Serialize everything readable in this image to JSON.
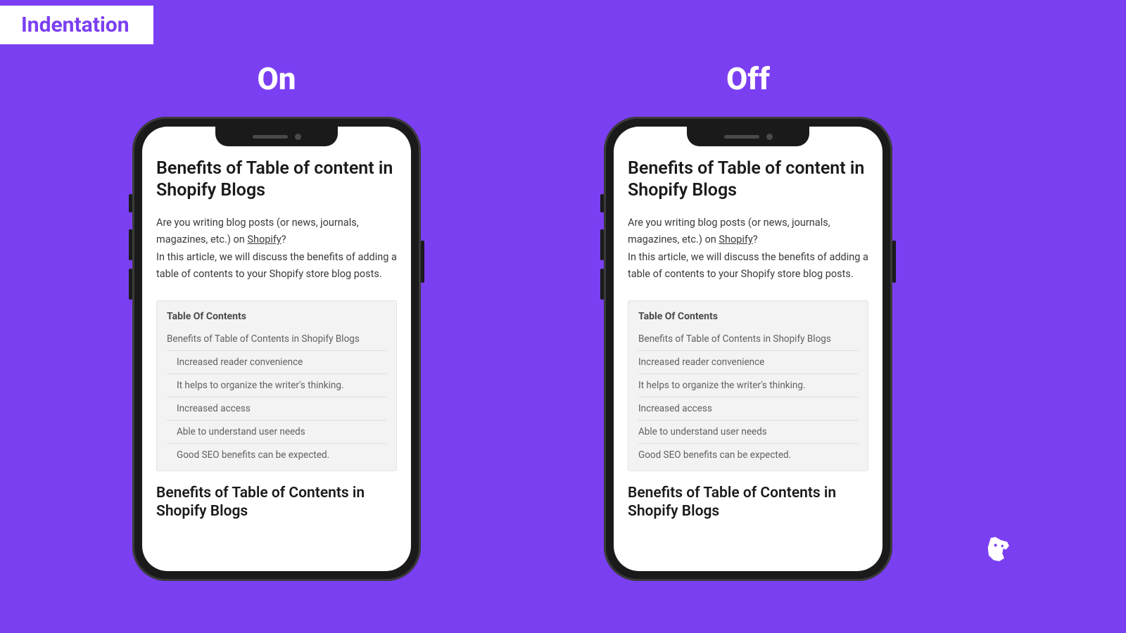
{
  "badge": "Indentation",
  "left": {
    "label": "On"
  },
  "right": {
    "label": "Off"
  },
  "article": {
    "title": "Benefits of Table of content in Shopify Blogs",
    "intro_a": "Are you writing blog posts (or news, journals, magazines, etc.) on ",
    "intro_link": "Shopify",
    "intro_b": "?",
    "intro_c": "In this article, we will discuss the benefits of adding a table of contents to your Shopify store blog posts.",
    "section_heading": "Benefits of Table of Contents in Shopify Blogs"
  },
  "toc": {
    "heading": "Table Of Contents",
    "items": [
      {
        "label": "Benefits of Table of Contents in Shopify Blogs",
        "level": 0
      },
      {
        "label": "Increased reader convenience",
        "level": 1
      },
      {
        "label": "It helps to organize the writer's thinking.",
        "level": 1
      },
      {
        "label": "Increased access",
        "level": 1
      },
      {
        "label": "Able to understand user needs",
        "level": 1
      },
      {
        "label": "Good SEO benefits can be expected.",
        "level": 1
      }
    ]
  }
}
